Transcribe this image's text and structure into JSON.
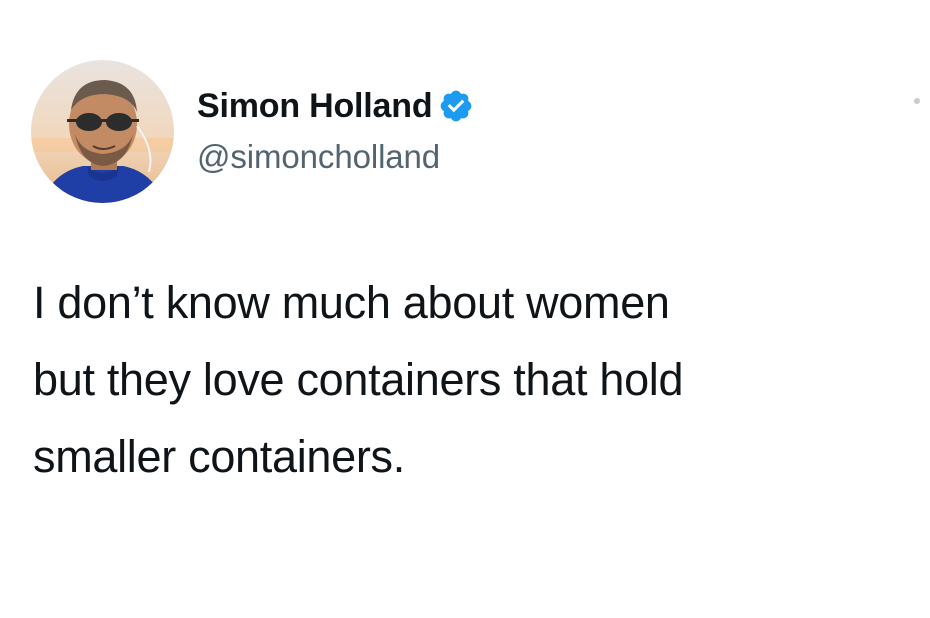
{
  "author": {
    "display_name": "Simon Holland",
    "handle": "@simoncholland",
    "verified": true,
    "avatar_icon": "profile-photo-man-sunglasses"
  },
  "tweet": {
    "lines": [
      "I don’t know much about women",
      "but they love containers that hold",
      "smaller containers."
    ]
  },
  "colors": {
    "name_text": "#0f1419",
    "handle_text": "#536471",
    "verified_badge": "#1d9bf0",
    "background": "#ffffff"
  },
  "icons": {
    "verified": "verified-badge-icon",
    "more": "more-options-icon"
  }
}
